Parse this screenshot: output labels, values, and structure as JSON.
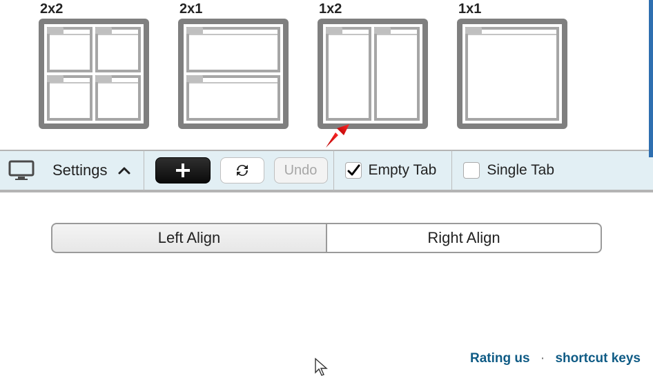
{
  "layouts": [
    {
      "label": "2x2"
    },
    {
      "label": "2x1"
    },
    {
      "label": "1x2"
    },
    {
      "label": "1x1"
    }
  ],
  "toolbar": {
    "settings_label": "Settings",
    "undo_label": "Undo",
    "empty_tab_label": "Empty Tab",
    "single_tab_label": "Single Tab",
    "empty_tab_checked": true,
    "single_tab_checked": false
  },
  "align": {
    "left_label": "Left Align",
    "right_label": "Right Align",
    "active": "left"
  },
  "footer": {
    "rating_label": "Rating us",
    "shortcut_label": "shortcut keys"
  }
}
